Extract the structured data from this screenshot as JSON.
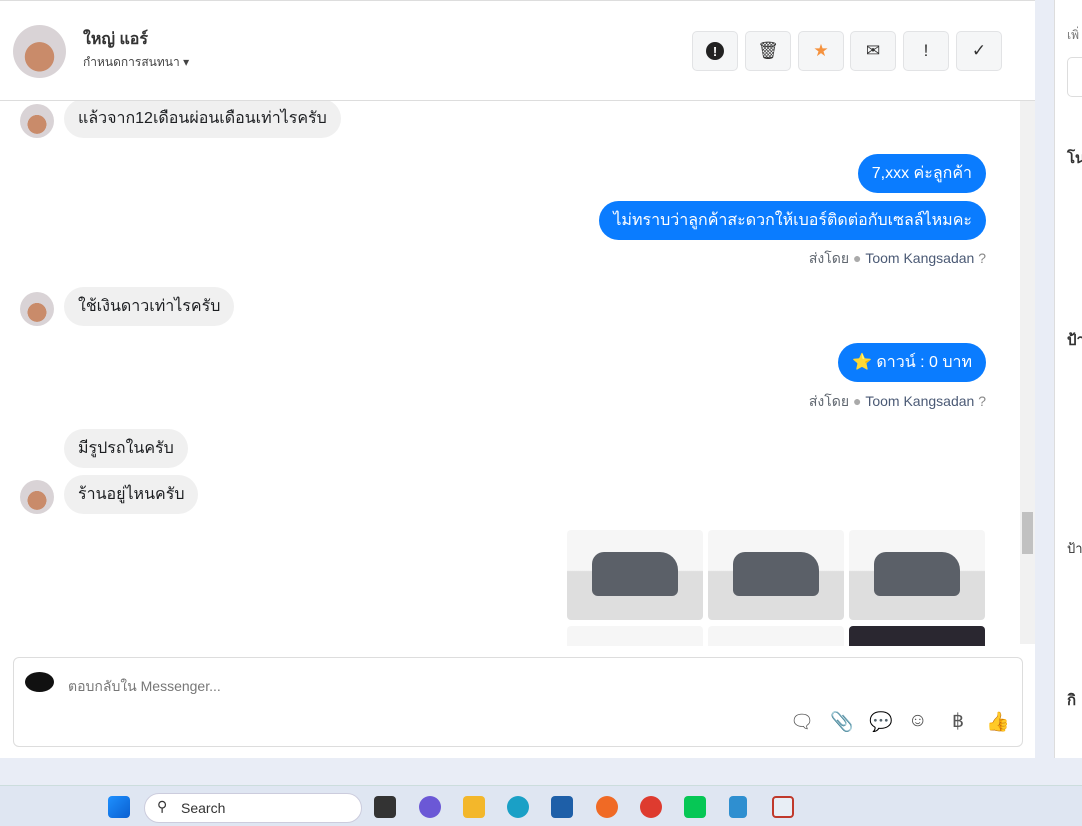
{
  "header": {
    "name": "ใหญ่ แอร์",
    "subtitle": "กำหนดการสนทนา",
    "actions": [
      "alert",
      "trash",
      "star",
      "mail",
      "exclamation",
      "check"
    ]
  },
  "messages": [
    {
      "side": "in",
      "text": "แล้วจาก12เดือนผ่อนเดือนเท่าไรครับ"
    },
    {
      "side": "out",
      "text": "7,xxx ค่ะลูกค้า"
    },
    {
      "side": "out",
      "text": "ไม่ทราบว่าลูกค้าสะดวกให้เบอร์ติดต่อกับเซลล์ไหมคะ"
    },
    {
      "side": "in",
      "text": "ใช้เงินดาวเท่าไรครับ"
    },
    {
      "side": "out",
      "text": "⭐ ดาวน์ : 0 บาท"
    },
    {
      "side": "in",
      "text": "มีรูปรถในครับ"
    },
    {
      "side": "in",
      "text": "ร้านอยู่ไหนครับ"
    }
  ],
  "sent_by": {
    "label": "ส่งโดย",
    "name": "Toom Kangsadan"
  },
  "compose": {
    "placeholder": "ตอบกลับใน Messenger..."
  },
  "right_panel": {
    "t1": "เพิ่",
    "t2": "โน",
    "t3": "ป้า",
    "t4": "ป้า",
    "t5": "กิ"
  },
  "taskbar": {
    "search": "Search"
  }
}
